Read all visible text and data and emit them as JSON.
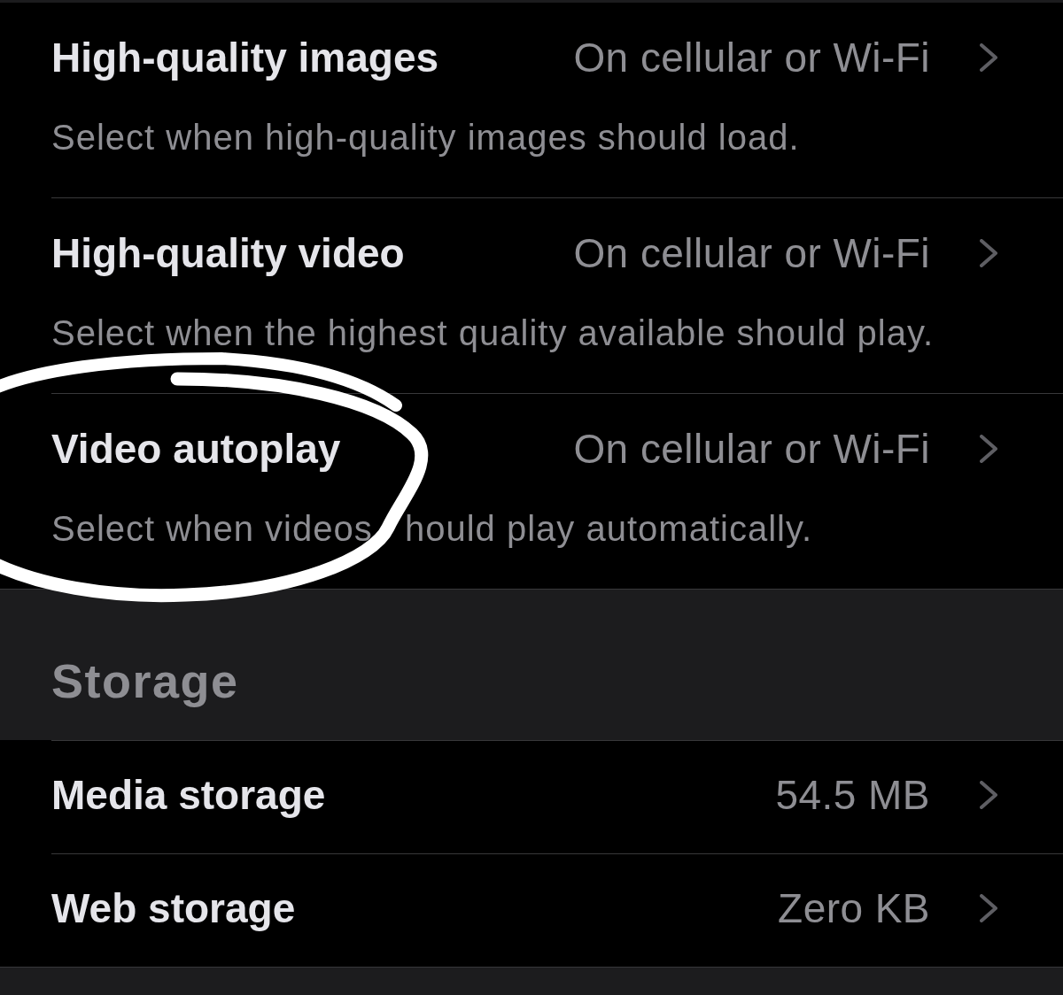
{
  "sections": [
    {
      "rows": [
        {
          "title": "High-quality images",
          "value": "On cellular or Wi-Fi",
          "description": "Select when high-quality images should load.",
          "circled": false
        },
        {
          "title": "High-quality video",
          "value": "On cellular or Wi-Fi",
          "description": "Select when the highest quality available should play.",
          "circled": false
        },
        {
          "title": "Video autoplay",
          "value": "On cellular or Wi-Fi",
          "description": "Select when videos   hould play automatically.",
          "circled": true
        }
      ]
    },
    {
      "header": "Storage",
      "rows": [
        {
          "title": "Media storage",
          "value": "54.5 MB",
          "circled": false
        },
        {
          "title": "Web storage",
          "value": "Zero KB",
          "circled": false
        }
      ]
    }
  ]
}
